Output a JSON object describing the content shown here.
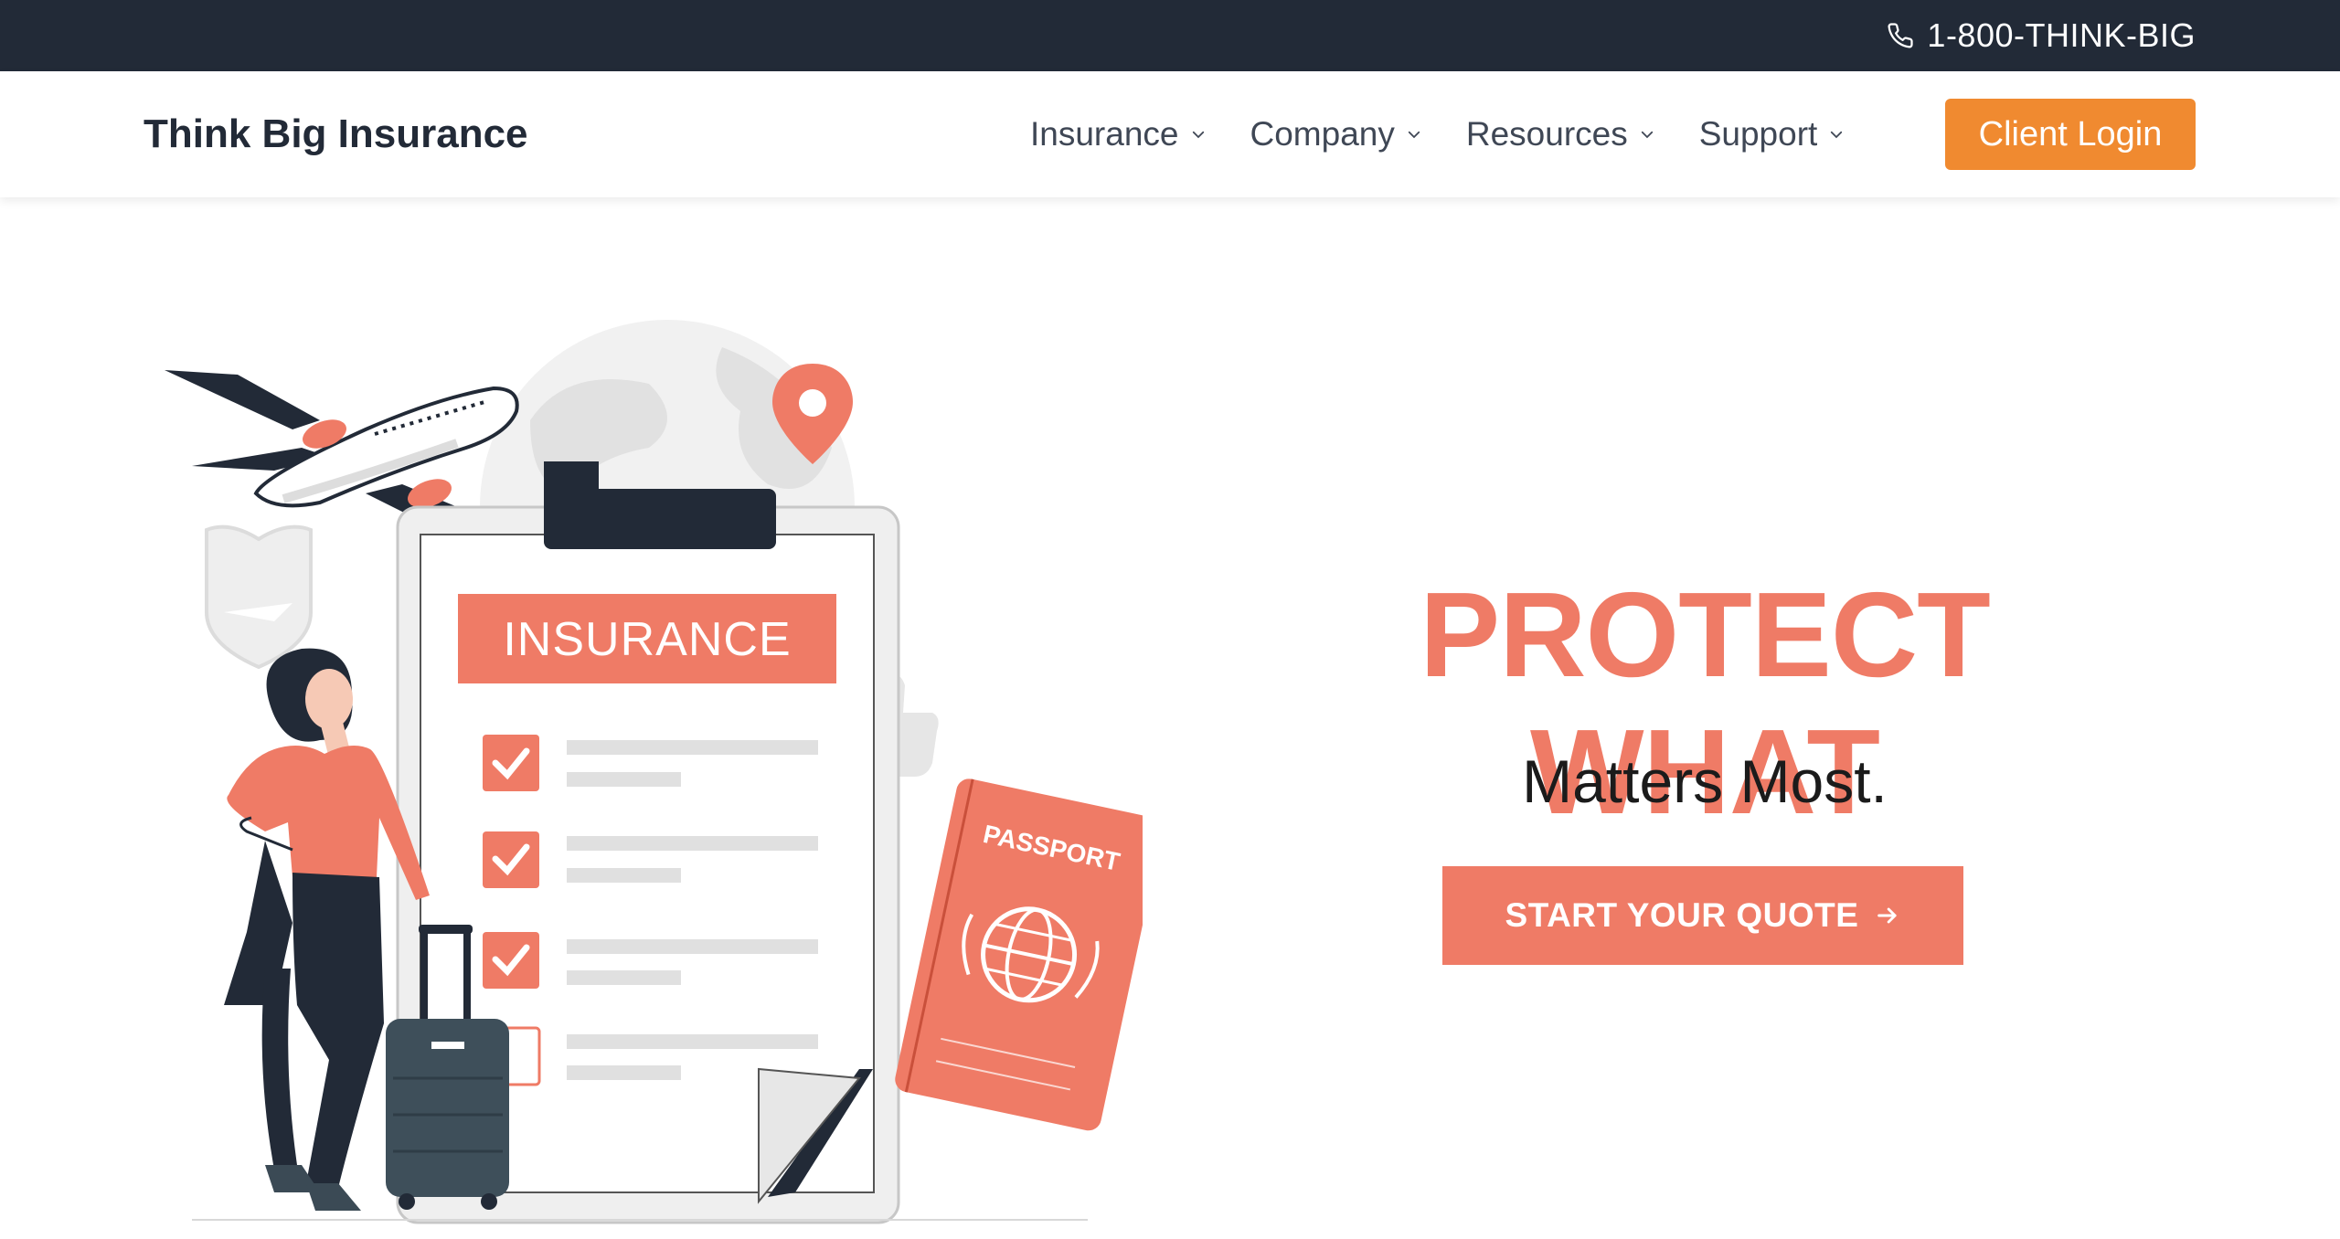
{
  "topbar": {
    "phone": "1-800-THINK-BIG",
    "phone_icon": "phone-icon"
  },
  "header": {
    "brand": "Think Big Insurance"
  },
  "nav": {
    "items": [
      {
        "label": "Insurance",
        "icon": "chevron-down-icon"
      },
      {
        "label": "Company",
        "icon": "chevron-down-icon"
      },
      {
        "label": "Resources",
        "icon": "chevron-down-icon"
      },
      {
        "label": "Support",
        "icon": "chevron-down-icon"
      }
    ],
    "login_label": "Client Login"
  },
  "hero": {
    "headline": "PROTECT WHAT",
    "subheadline": "Matters Most.",
    "cta_label": "START YOUR QUOTE",
    "cta_icon": "arrow-right-icon",
    "illustration": {
      "clipboard_title": "INSURANCE",
      "passport_label": "PASSPORT"
    }
  },
  "colors": {
    "topbar": "#222a37",
    "accent": "#ef7b66",
    "login": "#f08a30",
    "text_dark": "#222a37"
  }
}
